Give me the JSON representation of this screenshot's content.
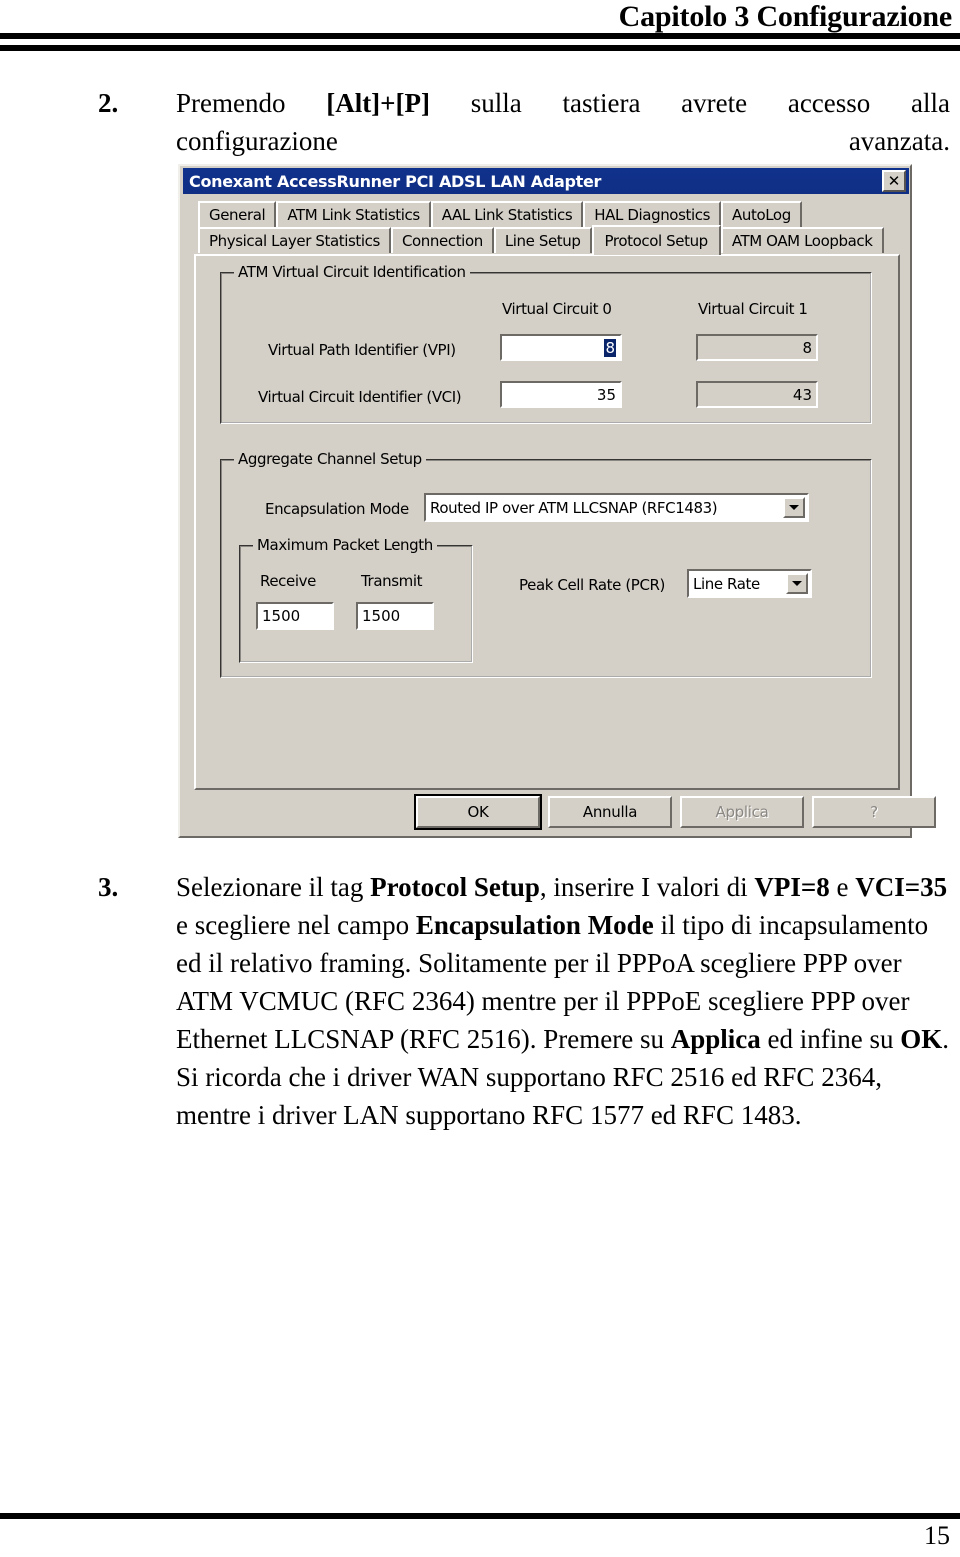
{
  "header": {
    "title": "Capitolo 3 Configurazione"
  },
  "steps": [
    {
      "number": "2.",
      "line1_a": "Premendo ",
      "line1_b": "[Alt]+[P]",
      "line1_c": " sulla tastiera avrete accesso alla",
      "line2_left": "configurazione",
      "line2_right": "avanzata."
    },
    {
      "number": "3.",
      "para_1a": "Selezionare il tag ",
      "para_1b": "Protocol Setup",
      "para_1c": ", inserire I valori di ",
      "para_1d": "VPI=8",
      "para_1e": " e ",
      "para_1f": "VCI=35",
      "para_1g": " e scegliere nel campo ",
      "para_1h": "Encapsulation Mode",
      "para_1i": " il tipo di incapsulamento ed il relativo framing. Solitamente per il PPPoA scegliere PPP over ATM VCMUC (RFC 2364) mentre per il PPPoE scegliere PPP over Ethernet LLCSNAP (RFC 2516). Premere su ",
      "para_1j": "Applica",
      "para_1k": " ed infine su ",
      "para_1l": "OK",
      "para_1m": ". Si ricorda che i driver WAN supportano RFC 2516 ed RFC 2364, mentre i driver LAN supportano RFC 1577 ed RFC 1483."
    }
  ],
  "dialog": {
    "title": "Conexant AccessRunner PCI ADSL LAN Adapter",
    "close_label": "✕",
    "tabs_row1": [
      {
        "label": "General",
        "selected": false
      },
      {
        "label": "ATM Link Statistics",
        "selected": false
      },
      {
        "label": "AAL Link Statistics",
        "selected": false
      },
      {
        "label": "HAL Diagnostics",
        "selected": false
      },
      {
        "label": "AutoLog",
        "selected": false
      }
    ],
    "tabs_row2": [
      {
        "label": "Physical Layer Statistics",
        "selected": false
      },
      {
        "label": "Connection",
        "selected": false
      },
      {
        "label": "Line Setup",
        "selected": false
      },
      {
        "label": "Protocol Setup",
        "selected": true
      },
      {
        "label": "ATM OAM Loopback",
        "selected": false
      }
    ],
    "vc_group": {
      "title": "ATM Virtual Circuit Identification",
      "col0_header": "Virtual Circuit 0",
      "col1_header": "Virtual Circuit 1",
      "row_vpi_label": "Virtual Path Identifier (VPI)",
      "row_vci_label": "Virtual Circuit Identifier (VCI)",
      "vc0_vpi": "8",
      "vc0_vci": "35",
      "vc1_vpi": "8",
      "vc1_vci": "43"
    },
    "aggregate_group": {
      "title": "Aggregate Channel Setup",
      "encapsulation_label": "Encapsulation Mode",
      "encapsulation_value": "Routed IP over ATM LLCSNAP (RFC1483)",
      "packet_group_title": "Maximum Packet Length",
      "receive_label": "Receive",
      "transmit_label": "Transmit",
      "receive_value": "1500",
      "transmit_value": "1500",
      "pcr_label": "Peak Cell Rate (PCR)",
      "pcr_value": "Line Rate"
    },
    "buttons": [
      {
        "label": "OK",
        "state": "default"
      },
      {
        "label": "Annulla",
        "state": "enabled"
      },
      {
        "label": "Applica",
        "state": "disabled"
      },
      {
        "label": "?",
        "state": "disabled"
      }
    ]
  },
  "footer": {
    "page_number": "15"
  },
  "colors": {
    "dialog_face": "#d4d0c8",
    "titlebar": "#11328c",
    "selection": "#0a246a",
    "rule": "#000000"
  }
}
